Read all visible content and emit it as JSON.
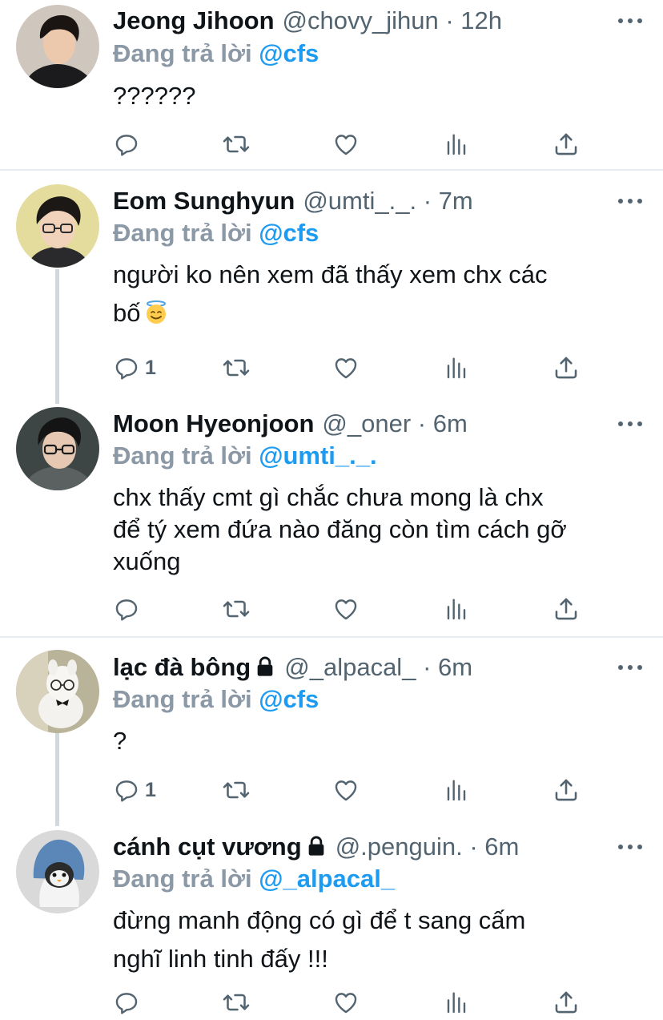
{
  "tweets": [
    {
      "name": "Jeong Jihoon",
      "handle": "@chovy_jihun",
      "time": "12h",
      "replying_prefix": "Đang trả lời",
      "replying_to": "@cfs",
      "lines": [
        "??????"
      ],
      "reply_count": ""
    },
    {
      "name": "Eom Sunghyun",
      "handle": "@umti_._.",
      "time": "7m",
      "replying_prefix": "Đang trả lời",
      "replying_to": "@cfs",
      "lines": [
        "người ko nên xem đã thấy xem chx các",
        "bố"
      ],
      "reply_count": "1"
    },
    {
      "name": "Moon Hyeonjoon",
      "handle": "@_oner",
      "time": "6m",
      "replying_prefix": "Đang trả lời",
      "replying_to": "@umti_._.",
      "lines": [
        "chx thấy cmt gì chắc chưa mong là chx",
        "để tý xem đứa nào đăng còn tìm cách gỡ",
        "xuống"
      ],
      "reply_count": ""
    },
    {
      "name": "lạc đà bông",
      "handle": "@_alpacal_",
      "time": "6m",
      "replying_prefix": "Đang trả lời",
      "replying_to": "@cfs",
      "lines": [
        "?"
      ],
      "reply_count": "1"
    },
    {
      "name": "cánh cụt vương",
      "handle": "@.penguin.",
      "time": "6m",
      "replying_prefix": "Đang trả lời",
      "replying_to": "@_alpacal_",
      "lines": [
        "đừng manh động có gì để t sang cấm",
        "nghĩ linh tinh đấy !!!"
      ],
      "reply_count": ""
    }
  ],
  "separator": "·",
  "icons": {
    "reply": "reply-icon",
    "retweet": "retweet-icon",
    "like": "heart-icon",
    "analytics": "analytics-icon",
    "share": "share-icon",
    "more": "more-icon",
    "lock": "lock-icon",
    "emoji": "smiling-face-with-halo-emoji"
  },
  "colors": {
    "accent": "#1d9bf0",
    "secondary": "#536471",
    "replying_gray": "#8b98a5",
    "text": "#0f1419",
    "divider": "#e6ecf0",
    "thread": "#cfd9de"
  }
}
